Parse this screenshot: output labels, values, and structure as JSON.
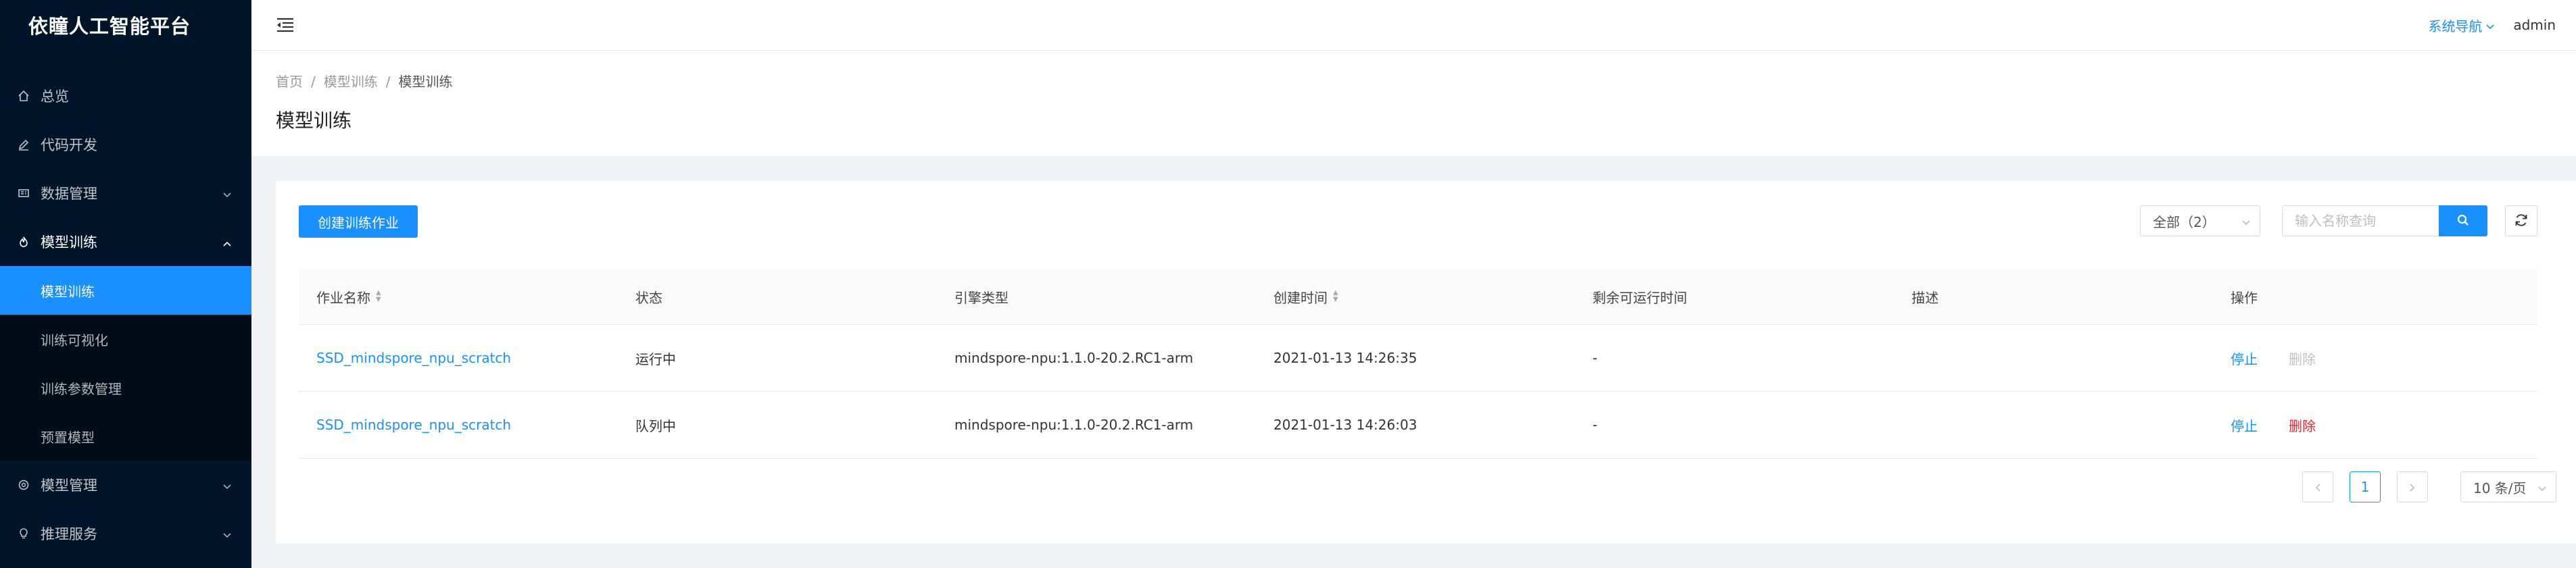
{
  "app": {
    "title": "依瞳人工智能平台"
  },
  "sidebar": {
    "items": [
      {
        "label": "总览",
        "icon": "home-icon"
      },
      {
        "label": "代码开发",
        "icon": "edit-icon"
      },
      {
        "label": "数据管理",
        "icon": "database-icon"
      },
      {
        "label": "模型训练",
        "icon": "flame-icon"
      },
      {
        "label": "模型管理",
        "icon": "model-icon"
      },
      {
        "label": "推理服务",
        "icon": "bulb-icon"
      }
    ],
    "training_sub": [
      {
        "label": "模型训练"
      },
      {
        "label": "训练可视化"
      },
      {
        "label": "训练参数管理"
      },
      {
        "label": "预置模型"
      }
    ]
  },
  "header": {
    "system_nav": "系统导航",
    "user": "admin"
  },
  "breadcrumb": [
    "首页",
    "模型训练",
    "模型训练"
  ],
  "page": {
    "title": "模型训练"
  },
  "toolbar": {
    "create_label": "创建训练作业",
    "filter_value": "全部（2）",
    "search_placeholder": "输入名称查询"
  },
  "table": {
    "columns": [
      "作业名称",
      "状态",
      "引擎类型",
      "创建时间",
      "剩余可运行时间",
      "描述",
      "操作"
    ],
    "rows": [
      {
        "name": "SSD_mindspore_npu_scratch",
        "status": "运行中",
        "engine": "mindspore-npu:1.1.0-20.2.RC1-arm",
        "created": "2021-01-13 14:26:35",
        "remaining": "-",
        "desc": "",
        "op_stop": "停止",
        "op_delete": "删除",
        "delete_enabled": false
      },
      {
        "name": "SSD_mindspore_npu_scratch",
        "status": "队列中",
        "engine": "mindspore-npu:1.1.0-20.2.RC1-arm",
        "created": "2021-01-13 14:26:03",
        "remaining": "-",
        "desc": "",
        "op_stop": "停止",
        "op_delete": "删除",
        "delete_enabled": true
      }
    ]
  },
  "pagination": {
    "current_page": "1",
    "page_size": "10 条/页"
  },
  "colors": {
    "accent": "#1890ff",
    "sidebar_bg": "#001529",
    "danger": "#f5222d"
  }
}
